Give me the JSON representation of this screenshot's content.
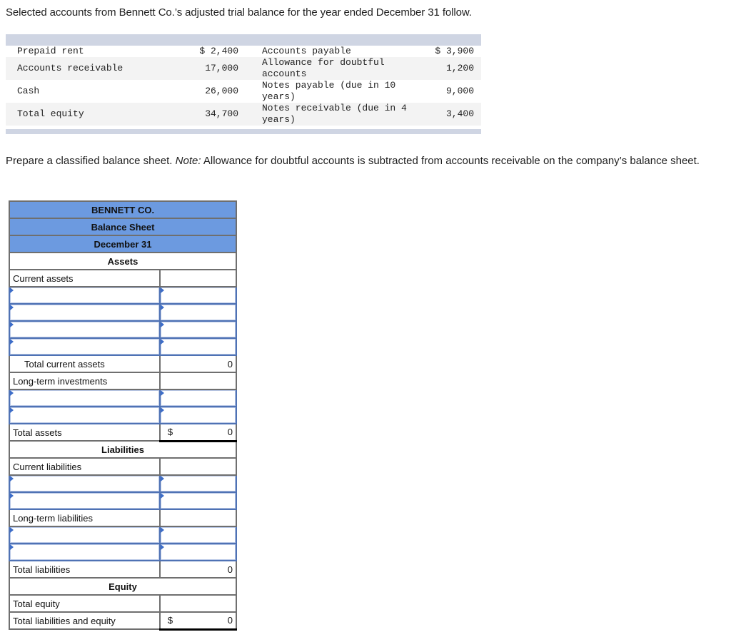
{
  "intro": "Selected accounts from Bennett Co.’s adjusted trial balance for the year ended December 31 follow.",
  "trial_balance": {
    "rows": [
      {
        "left_label": "Prepaid rent",
        "left_value": "$ 2,400",
        "right_label": "Accounts payable",
        "right_value": "$ 3,900"
      },
      {
        "left_label": "Accounts receivable",
        "left_value": "17,000",
        "right_label": "Allowance for doubtful accounts",
        "right_value": "1,200"
      },
      {
        "left_label": "Cash",
        "left_value": "26,000",
        "right_label": "Notes payable (due in 10 years)",
        "right_value": "9,000"
      },
      {
        "left_label": "Total equity",
        "left_value": "34,700",
        "right_label": "Notes receivable (due in 4 years)",
        "right_value": "3,400"
      }
    ]
  },
  "prompt": {
    "lead": "Prepare a classified balance sheet.",
    "note_label": "Note:",
    "note_text": "Allowance for doubtful accounts is subtracted from accounts receivable on the company’s balance sheet."
  },
  "balance_sheet": {
    "company": "BENNETT CO.",
    "title": "Balance Sheet",
    "date": "December 31",
    "assets_heading": "Assets",
    "current_assets_label": "Current assets",
    "total_current_assets_label": "Total current assets",
    "total_current_assets_value": "0",
    "long_term_investments_label": "Long-term investments",
    "total_assets_label": "Total assets",
    "total_assets_currency": "$",
    "total_assets_value": "0",
    "liabilities_heading": "Liabilities",
    "current_liabilities_label": "Current liabilities",
    "long_term_liabilities_label": "Long-term liabilities",
    "total_liabilities_label": "Total liabilities",
    "total_liabilities_value": "0",
    "equity_heading": "Equity",
    "total_equity_label": "Total equity",
    "total_liabilities_equity_label": "Total liabilities and equity",
    "total_liabilities_equity_currency": "$",
    "total_liabilities_equity_value": "0",
    "inputs": {
      "current_assets": [
        {
          "label": "",
          "amount": ""
        },
        {
          "label": "",
          "amount": ""
        },
        {
          "label": "",
          "amount": ""
        },
        {
          "label": "",
          "amount": ""
        }
      ],
      "long_term_investments": [
        {
          "label": "",
          "amount": ""
        },
        {
          "label": "",
          "amount": ""
        }
      ],
      "current_liabilities": [
        {
          "label": "",
          "amount": ""
        },
        {
          "label": "",
          "amount": ""
        }
      ],
      "long_term_liabilities": [
        {
          "label": "",
          "amount": ""
        },
        {
          "label": "",
          "amount": ""
        }
      ]
    }
  }
}
